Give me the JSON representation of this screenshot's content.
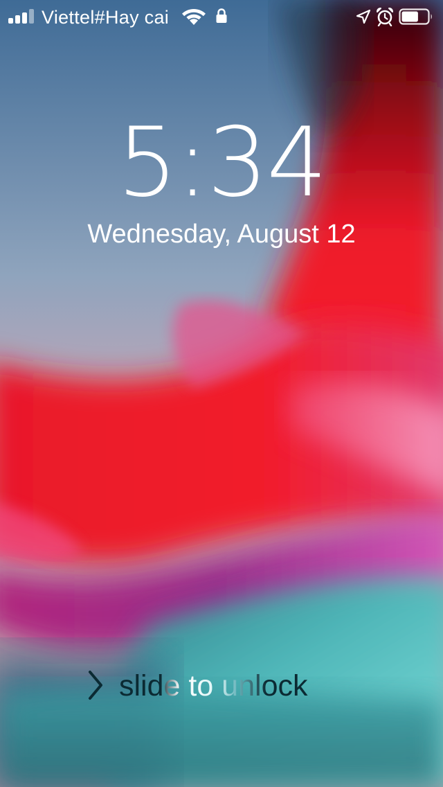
{
  "status_bar": {
    "carrier": "Viettel#Hay cai",
    "signal_bars_filled": 3,
    "signal_bars_total": 4,
    "icons": [
      "signal-icon",
      "wifi-icon",
      "lock-icon",
      "location-arrow-icon",
      "alarm-clock-icon",
      "battery-icon"
    ],
    "battery_level": 0.65
  },
  "lock_screen": {
    "time": "5:34",
    "date": "Wednesday, August 12",
    "slide_label": "slide to unlock",
    "slide_icon": "chevron-right-icon"
  },
  "colors": {
    "accent_red": "#f0182c",
    "accent_teal": "#52c9c8",
    "accent_blue": "#4e78a0",
    "accent_magenta": "#d64196"
  }
}
